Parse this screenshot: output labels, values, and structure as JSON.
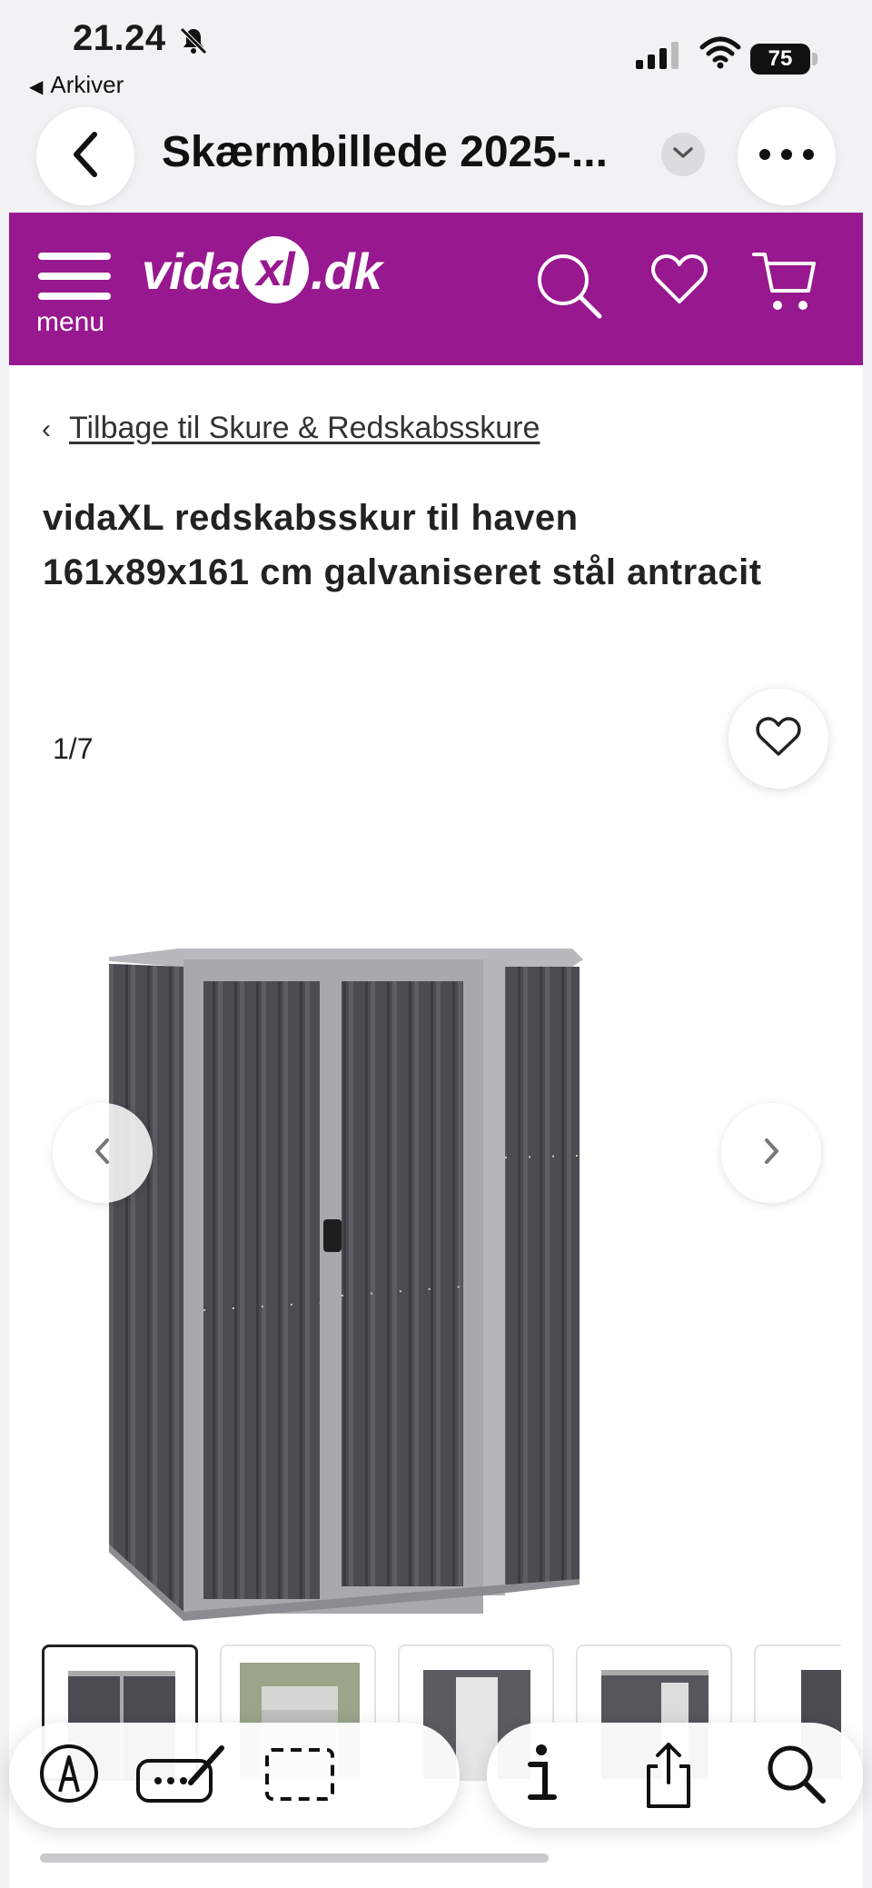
{
  "status_bar": {
    "time": "21.24",
    "back_app": "Arkiver",
    "battery": "75"
  },
  "nav": {
    "title": "Skærmbillede 2025-..."
  },
  "site": {
    "logo_text_1": "vida",
    "logo_text_2": "xl",
    "logo_text_3": ".dk",
    "menu_label": "menu",
    "brand_color": "#98188f"
  },
  "breadcrumb": {
    "text": "Tilbage til Skure & Redskabsskure"
  },
  "product": {
    "title": "vidaXL redskabsskur til haven 161x89x161 cm galvaniseret stål antracit"
  },
  "gallery": {
    "counter": "1/7"
  },
  "thumbnails": [
    "shed-front",
    "shed-garden",
    "shed-open",
    "shed-side",
    "shed-partial"
  ],
  "icons": {
    "nav": [
      "back-icon",
      "chevron-down-icon",
      "more-icon"
    ],
    "header": [
      "menu-icon",
      "search-icon",
      "heart-icon",
      "cart-icon"
    ],
    "toolbar": [
      "markup-icon",
      "signature-icon",
      "selection-icon",
      "info-icon",
      "share-icon",
      "search-icon"
    ]
  }
}
